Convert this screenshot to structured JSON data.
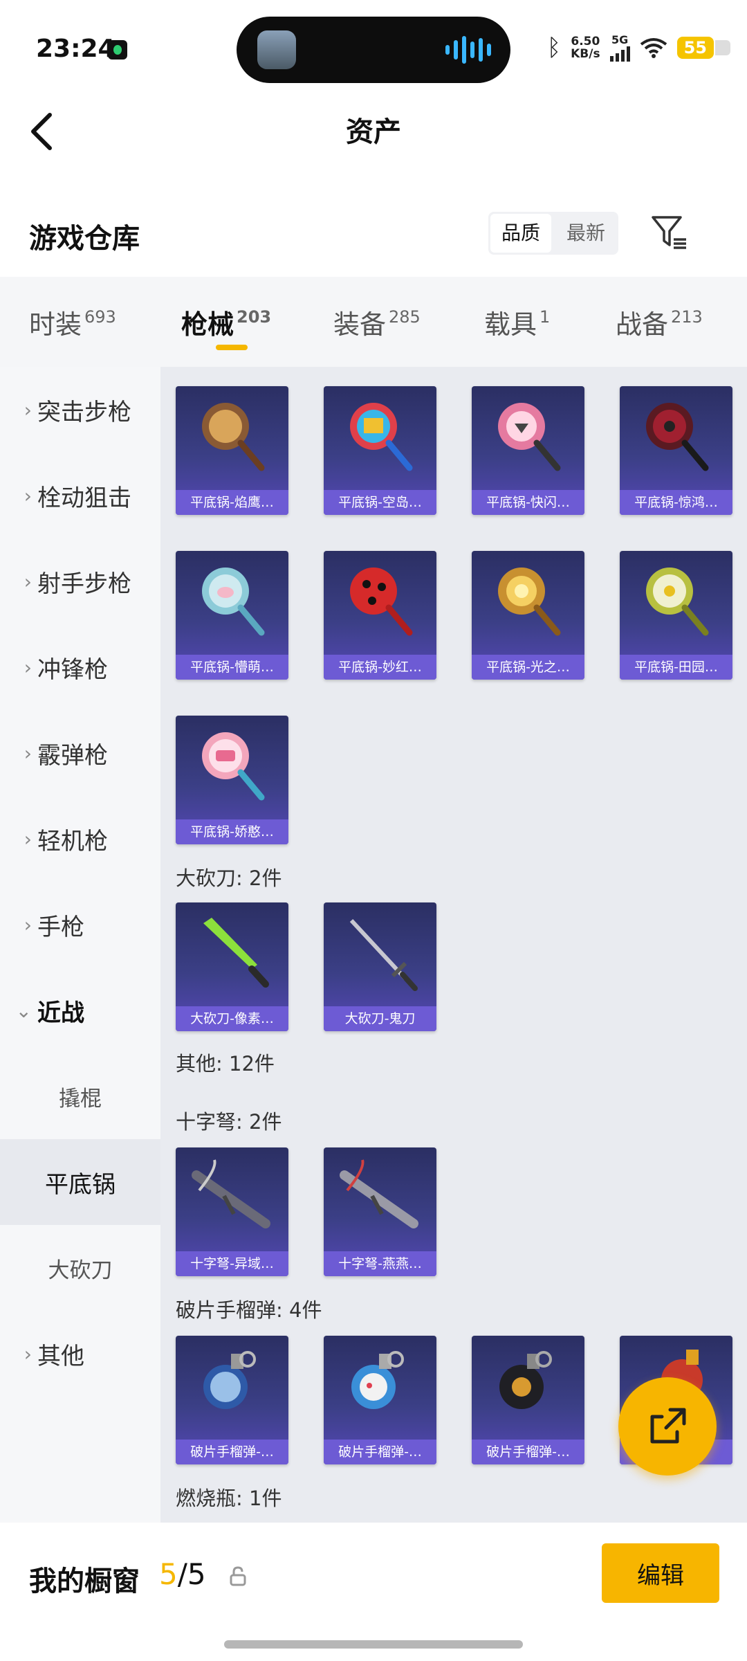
{
  "status_bar": {
    "time": "23:24",
    "net_speed_value": "6.50",
    "net_speed_unit": "KB/s",
    "signal_label": "5G",
    "battery": "55"
  },
  "nav": {
    "title": "资产"
  },
  "section": {
    "title": "游戏仓库",
    "sort_options": [
      "品质",
      "最新"
    ],
    "active_sort": "品质"
  },
  "tabs": [
    {
      "label": "时装",
      "count": "693"
    },
    {
      "label": "枪械",
      "count": "203"
    },
    {
      "label": "装备",
      "count": "285"
    },
    {
      "label": "载具",
      "count": "1"
    },
    {
      "label": "战备",
      "count": "213"
    }
  ],
  "active_tab": "枪械",
  "sidebar": {
    "items": [
      "突击步枪",
      "栓动狙击",
      "射手步枪",
      "冲锋枪",
      "霰弹枪",
      "轻机枪",
      "手枪",
      "近战"
    ],
    "sub_items": [
      "撬棍",
      "平底锅",
      "大砍刀"
    ],
    "last_item": "其他",
    "active_sub": "平底锅"
  },
  "groups": {
    "machete_label": "大砍刀: 2件",
    "other_label": "其他: 12件",
    "crossbow_label": "十字弩: 2件",
    "grenade_label": "破片手榴弹: 4件",
    "molotov_label": "燃烧瓶: 1件"
  },
  "items": {
    "pans": [
      "平底锅-焰鹰…",
      "平底锅-空岛…",
      "平底锅-快闪…",
      "平底锅-惊鸿…",
      "平底锅-懵萌…",
      "平底锅-妙红…",
      "平底锅-光之…",
      "平底锅-田园…",
      "平底锅-娇憨…"
    ],
    "machetes": [
      "大砍刀-像素…",
      "大砍刀-鬼刀"
    ],
    "crossbows": [
      "十字弩-异域…",
      "十字弩-燕燕…"
    ],
    "grenades": [
      "破片手榴弹-…",
      "破片手榴弹-…",
      "破片手榴弹-…",
      ""
    ]
  },
  "bottom": {
    "showcase_label": "我的橱窗",
    "showcase_used": "5",
    "showcase_total": "/5",
    "edit_label": "编辑"
  },
  "colors": {
    "accent": "#f5b700",
    "card_label_bg": "#6d5bd4",
    "card_bg": "#3b3f86"
  }
}
